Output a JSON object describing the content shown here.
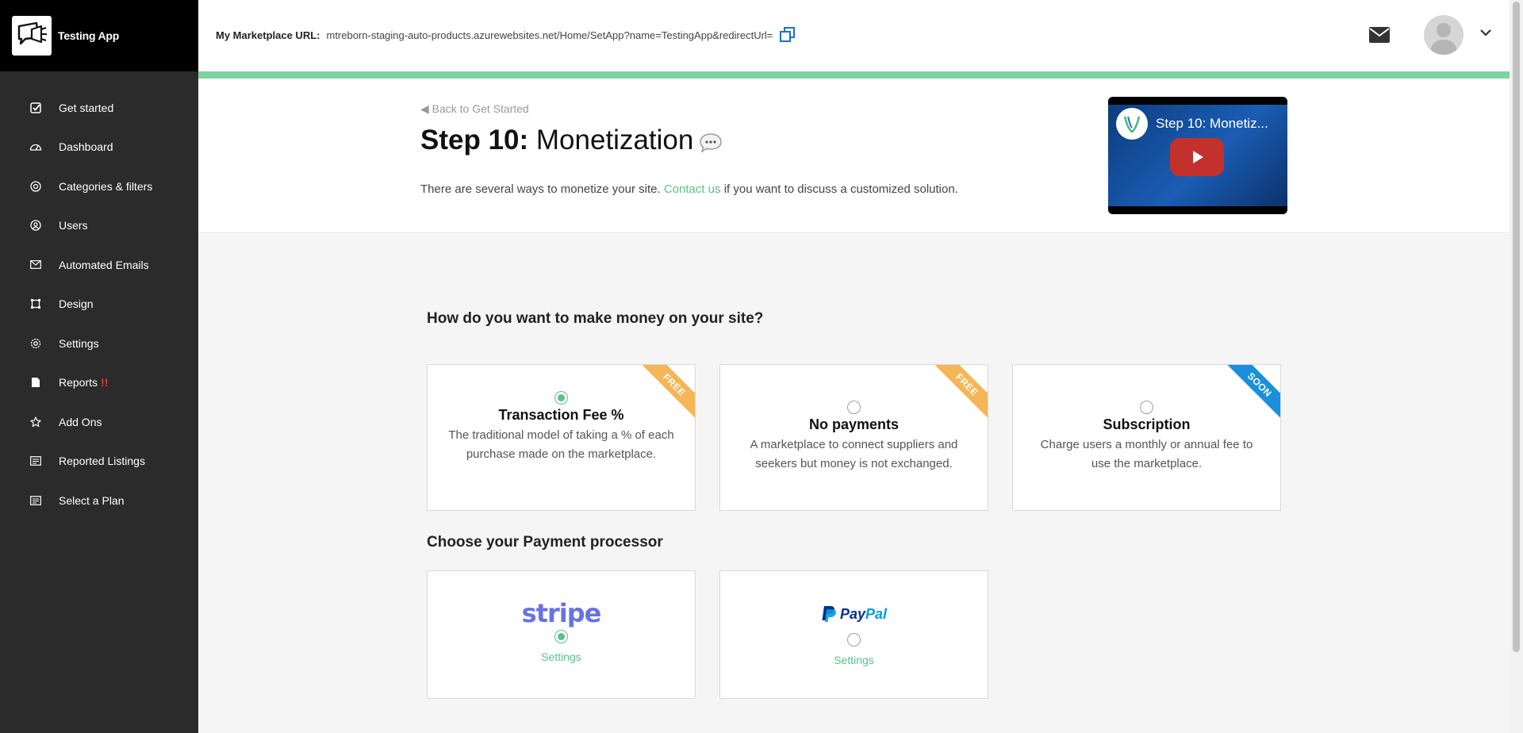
{
  "app": {
    "name": "Testing App"
  },
  "sidebar": {
    "items": [
      {
        "label": "Get started",
        "icon": "checkbox-icon"
      },
      {
        "label": "Dashboard",
        "icon": "speedometer-icon"
      },
      {
        "label": "Categories & filters",
        "icon": "target-icon"
      },
      {
        "label": "Users",
        "icon": "user-circle-icon"
      },
      {
        "label": "Automated Emails",
        "icon": "envelope-icon"
      },
      {
        "label": "Design",
        "icon": "crop-icon"
      },
      {
        "label": "Settings",
        "icon": "gear-icon"
      },
      {
        "label": "Reports",
        "icon": "document-icon",
        "alert": "!!"
      },
      {
        "label": "Add Ons",
        "icon": "star-icon"
      },
      {
        "label": "Reported Listings",
        "icon": "list-icon"
      },
      {
        "label": "Select a Plan",
        "icon": "list-icon"
      }
    ]
  },
  "topbar": {
    "url_label": "My Marketplace URL:",
    "url_value": "mtreborn-staging-auto-products.azurewebsites.net/Home/SetApp?name=TestingApp&redirectUrl="
  },
  "header": {
    "back_link": "◀ Back to Get Started",
    "title_step": "Step 10:",
    "title_name": "Monetization",
    "intro_before": "There are several ways to monetize your site.",
    "intro_link": "Contact us",
    "intro_after": "if you want to discuss a customized solution.",
    "video_title": "Step 10: Monetiz..."
  },
  "monetization": {
    "question": "How do you want to make money on your site?",
    "options": [
      {
        "title": "Transaction Fee %",
        "description": "The traditional model of taking a % of each purchase made on the marketplace.",
        "ribbon": "FREE",
        "selected": true
      },
      {
        "title": "No payments",
        "description": "A marketplace to connect suppliers and seekers but money is not exchanged.",
        "ribbon": "FREE",
        "selected": false
      },
      {
        "title": "Subscription",
        "description": "Charge users a monthly or annual fee to use the marketplace.",
        "ribbon": "SOON",
        "selected": false
      }
    ]
  },
  "processor": {
    "heading": "Choose your Payment processor",
    "options": [
      {
        "brand": "stripe",
        "settings": "Settings",
        "selected": true
      },
      {
        "brand_pay": "Pay",
        "brand_pal": "Pal",
        "settings": "Settings",
        "selected": false
      }
    ]
  },
  "colors": {
    "accent": "#5cc08a",
    "progress": "#7dd4a1",
    "sidebar_bg": "#2b2b2b",
    "ribbon_free": "#f4b657",
    "ribbon_soon": "#1a8fdb",
    "stripe": "#6772e5"
  }
}
